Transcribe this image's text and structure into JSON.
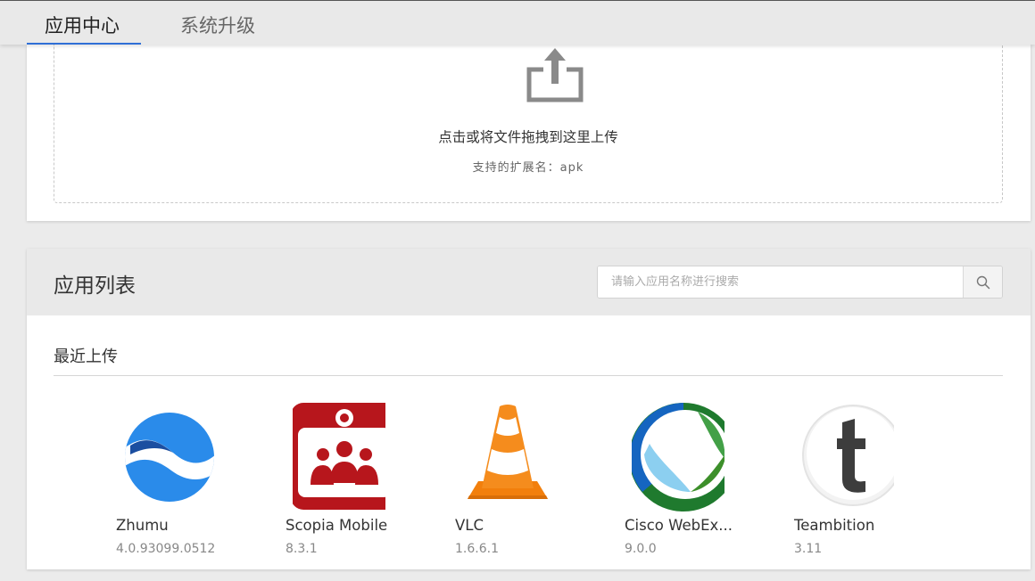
{
  "tabs": [
    {
      "label": "应用中心",
      "active": true
    },
    {
      "label": "系统升级",
      "active": false
    }
  ],
  "upload": {
    "main_text": "点击或将文件拖拽到这里上传",
    "sub_text": "支持的扩展名：apk",
    "icon": "upload-icon"
  },
  "app_list": {
    "title": "应用列表",
    "search_placeholder": "请输入应用名称进行搜索",
    "search_icon": "search-icon",
    "section_title": "最近上传",
    "apps": [
      {
        "name": "Zhumu",
        "version": "4.0.93099.0512",
        "icon": "zhumu-icon"
      },
      {
        "name": "Scopia Mobile",
        "version": "8.3.1",
        "icon": "scopia-icon"
      },
      {
        "name": "VLC",
        "version": "1.6.6.1",
        "icon": "vlc-cone-icon"
      },
      {
        "name": "Cisco WebEx...",
        "version": "9.0.0",
        "icon": "webex-icon"
      },
      {
        "name": "Teambition",
        "version": "3.11",
        "icon": "teambition-icon"
      }
    ]
  },
  "colors": {
    "accent": "#2f6fd6",
    "header_bg": "#e9e9e9",
    "page_bg": "#ebebeb"
  }
}
